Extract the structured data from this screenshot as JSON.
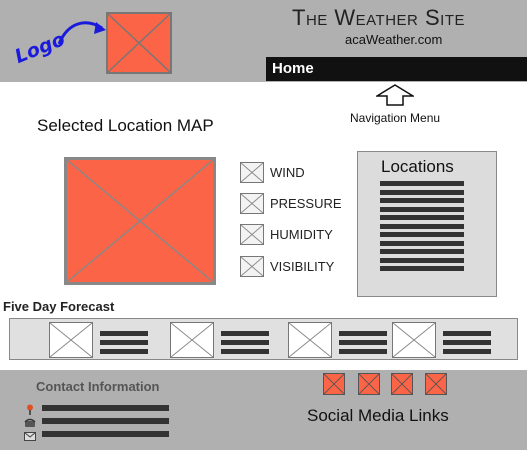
{
  "header": {
    "logo_annotation": "Logo",
    "site_title": "The Weather Site",
    "site_subtitle": "acaWeather.com"
  },
  "nav": {
    "items": [
      {
        "label": "Home"
      }
    ],
    "annotation": "Navigation Menu"
  },
  "map": {
    "title": "Selected Location MAP"
  },
  "conditions": [
    {
      "label": "WIND"
    },
    {
      "label": "PRESSURE"
    },
    {
      "label": "HUMIDITY"
    },
    {
      "label": "VISIBILITY"
    }
  ],
  "locations": {
    "title": "Locations"
  },
  "forecast": {
    "title": "Five Day Forecast"
  },
  "footer": {
    "contact_title": "Contact Information",
    "social_label": "Social Media Links"
  },
  "colors": {
    "placeholder_red": "#fb6446",
    "header_gray": "#b0b0b0",
    "nav_black": "#111111",
    "annotation_blue": "#1a1adc"
  },
  "icons": [
    "logo-placeholder-icon",
    "arrow-icon",
    "up-arrow-icon",
    "map-placeholder-icon",
    "checkbox-icon",
    "image-placeholder-icon",
    "location-pin-icon",
    "phone-icon",
    "mail-icon",
    "social-icon"
  ]
}
